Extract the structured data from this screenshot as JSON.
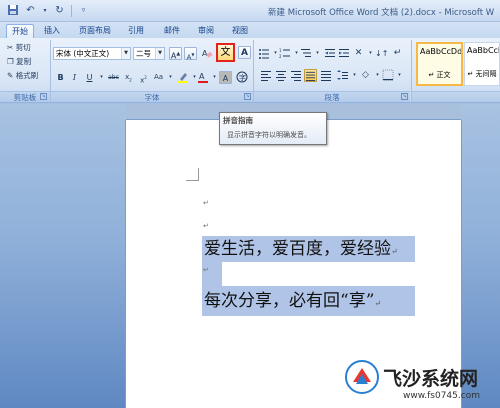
{
  "title_bar": {
    "doc_title": "新建 Microsoft Office Word 文档 (2).docx - Microsoft W",
    "qat_icons": [
      "save-icon",
      "undo-icon",
      "redo-icon",
      "customize-icon"
    ]
  },
  "tabs": [
    "开始",
    "插入",
    "页面布局",
    "引用",
    "邮件",
    "审阅",
    "视图"
  ],
  "active_tab": "开始",
  "clipboard": {
    "cut": "剪切",
    "copy": "复制",
    "format_painter": "格式刷",
    "group_label": "剪贴板"
  },
  "font": {
    "font_name": "宋体 (中文正文)",
    "font_size": "二号",
    "group_label": "字体",
    "phonetic_guide_glyph": "文",
    "char_border_glyph": "A"
  },
  "paragraph": {
    "group_label": "段落"
  },
  "styles": {
    "items": [
      {
        "sample": "AaBbCcDd",
        "name": "↵ 正文"
      },
      {
        "sample": "AaBbCcDd",
        "name": "↵ 无间隔"
      }
    ]
  },
  "tooltip": {
    "title": "拼音指南",
    "body": "显示拼音字符以明确发音。"
  },
  "document": {
    "para_mark": "↵",
    "lines": [
      "爱生活，爱百度，爱经验",
      "每次分享，必有回“享”"
    ]
  },
  "watermark": {
    "name": "飞沙系统网",
    "url": "www.fs0745.com"
  },
  "colors": {
    "ribbon": "#dbe7f6",
    "selection": "#afc4e6",
    "highlight_border": "#e0241d",
    "workspace": "#8fb0d9"
  }
}
